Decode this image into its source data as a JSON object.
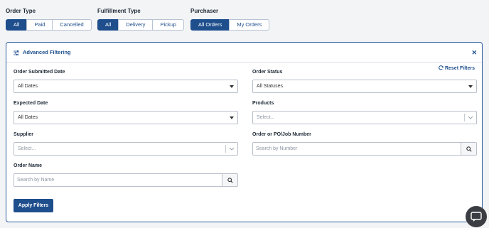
{
  "filters": {
    "order_type": {
      "title": "Order Type",
      "options": [
        "All",
        "Paid",
        "Cancelled"
      ],
      "selected": "All"
    },
    "fulfillment_type": {
      "title": "Fulfillment Type",
      "options": [
        "All",
        "Delivery",
        "Pickup"
      ],
      "selected": "All"
    },
    "purchaser": {
      "title": "Purchaser",
      "options": [
        "All Orders",
        "My Orders"
      ],
      "selected": "All Orders"
    }
  },
  "advanced": {
    "title": "Advanced Filtering",
    "reset_label": "Reset Filters",
    "order_submitted_date": {
      "label": "Order Submitted Date",
      "value": "All Dates"
    },
    "order_status": {
      "label": "Order Status",
      "value": "All Statuses"
    },
    "expected_date": {
      "label": "Expected Date",
      "value": "All Dates"
    },
    "products": {
      "label": "Products",
      "placeholder": "Select..."
    },
    "supplier": {
      "label": "Supplier",
      "placeholder": "Select..."
    },
    "order_number": {
      "label": "Order or PO/Job Number",
      "placeholder": "Search by Number"
    },
    "order_name": {
      "label": "Order Name",
      "placeholder": "Search by Name"
    },
    "apply_label": "Apply Filters"
  },
  "colors": {
    "accent": "#1e4e8c",
    "border": "#2c5aa0"
  },
  "icons": {
    "filter": "sliders-icon",
    "close": "close-icon",
    "reset": "refresh-icon",
    "search": "search-icon",
    "chat": "chat-icon"
  }
}
